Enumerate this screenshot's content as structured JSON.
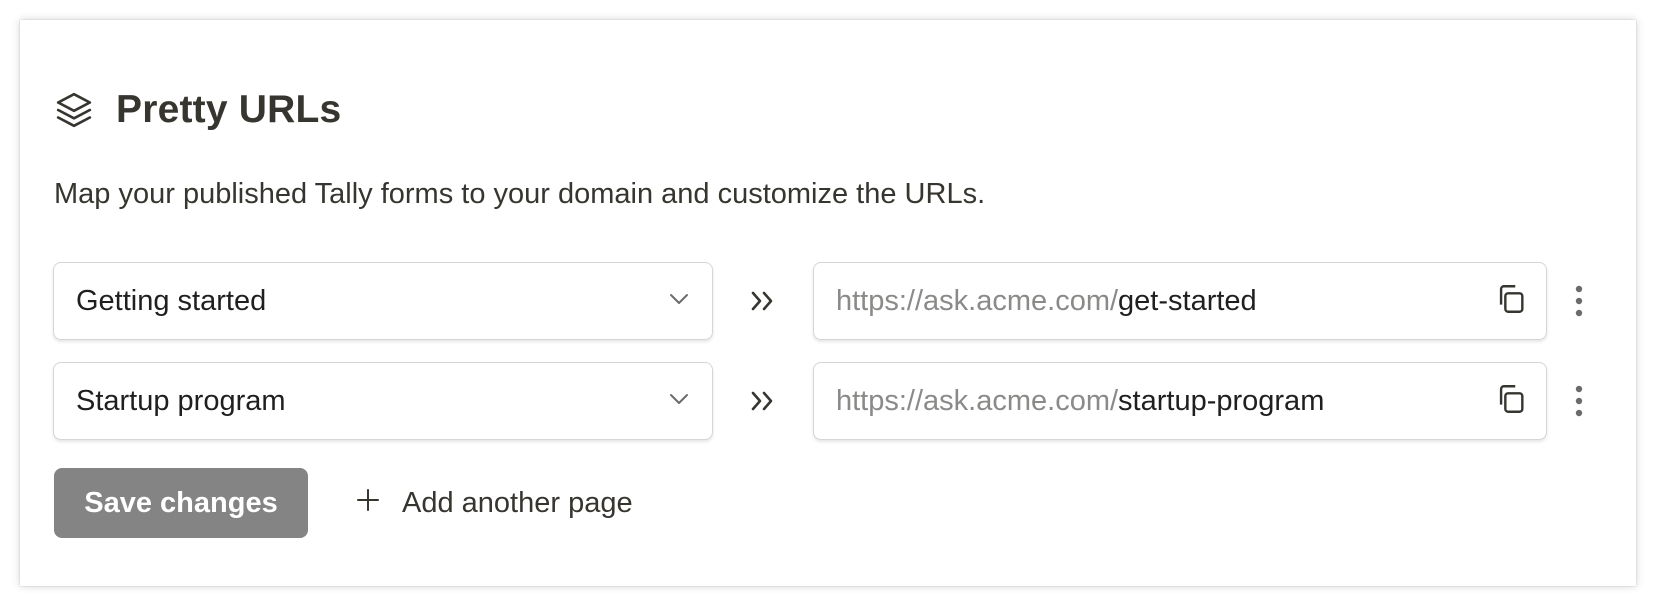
{
  "section": {
    "title": "Pretty URLs",
    "icon": "layers-icon",
    "description": "Map your published Tally forms to your domain and customize the URLs."
  },
  "mappings": [
    {
      "form": "Getting started",
      "url_prefix": "https://ask.acme.com/",
      "url_slug": "get-started"
    },
    {
      "form": "Startup program",
      "url_prefix": "https://ask.acme.com/",
      "url_slug": "startup-program"
    }
  ],
  "actions": {
    "save_label": "Save changes",
    "add_label": "Add another page"
  },
  "colors": {
    "text": "#37352f",
    "muted": "#8a8a88",
    "button_bg": "#848484",
    "border": "#d6d6d4"
  }
}
